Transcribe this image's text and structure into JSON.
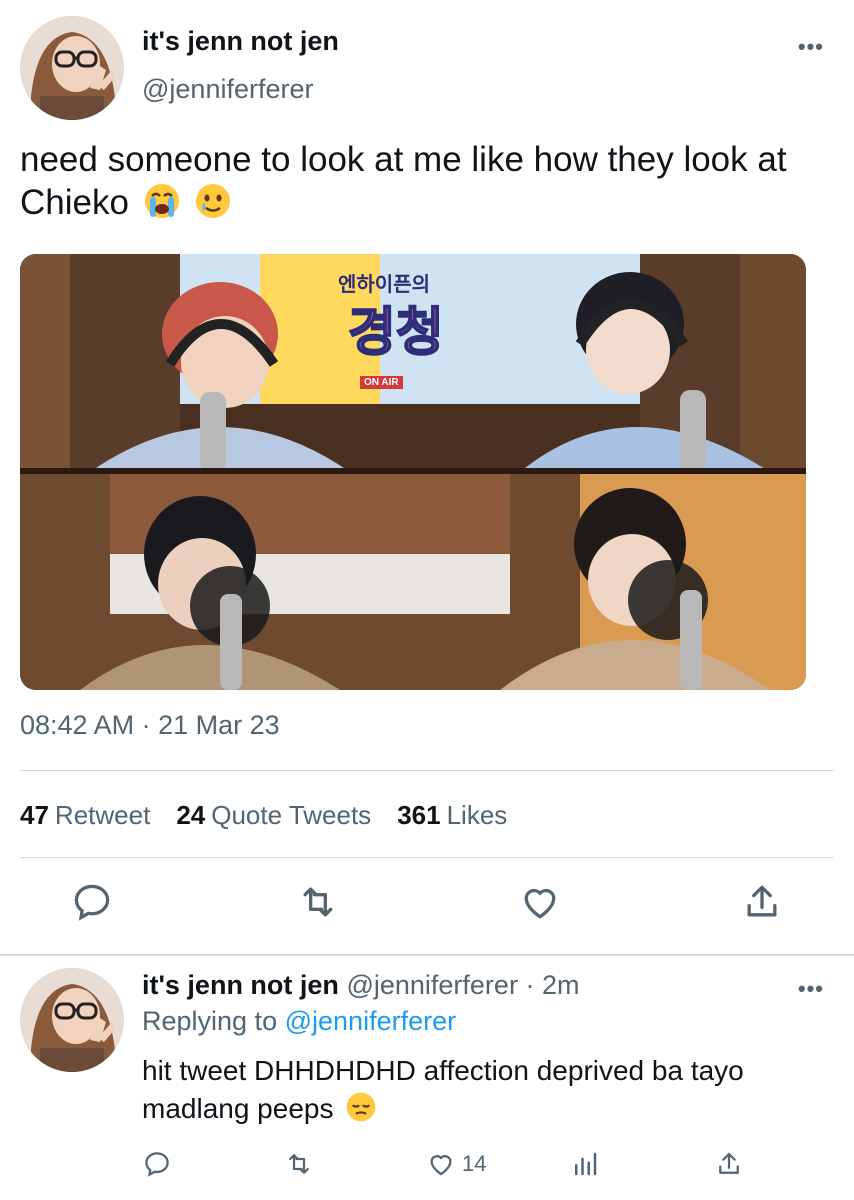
{
  "tweet": {
    "author_name": "it's jenn not jen",
    "author_handle": "@jenniferferer",
    "more_icon": "more-icon",
    "text": "need someone to look at me like how they look at Chieko",
    "emojis": [
      "loudly-crying-face-emoji",
      "face-holding-back-tears-emoji"
    ],
    "media_caption_korean_small": "엔하이픈의",
    "media_caption_korean_big": "경청",
    "media_logo_badge": "ON AIR",
    "timestamp": "08:42 AM · 21 Mar 23",
    "stats": {
      "retweets_count": "47",
      "retweets_label": "Retweet",
      "quotes_count": "24",
      "quotes_label": "Quote Tweets",
      "likes_count": "361",
      "likes_label": "Likes"
    },
    "actions": [
      "reply-icon",
      "retweet-icon",
      "like-icon",
      "share-icon"
    ]
  },
  "reply": {
    "author_name": "it's jenn not jen",
    "author_handle": "@jenniferferer",
    "time": "· 2m",
    "replying_to_label": "Replying to",
    "replying_to_handle": "@jenniferferer",
    "text": "hit tweet DHHDHDHD affection deprived ba tayo madlang peeps",
    "emoji": "pensive-face-emoji",
    "like_count": "14",
    "actions": [
      "reply-icon",
      "retweet-icon",
      "like-icon",
      "analytics-icon",
      "share-icon"
    ]
  },
  "colors": {
    "text_primary": "#0f1419",
    "text_secondary": "#536471",
    "link": "#1d9bf0",
    "divider": "#cfd9de"
  }
}
